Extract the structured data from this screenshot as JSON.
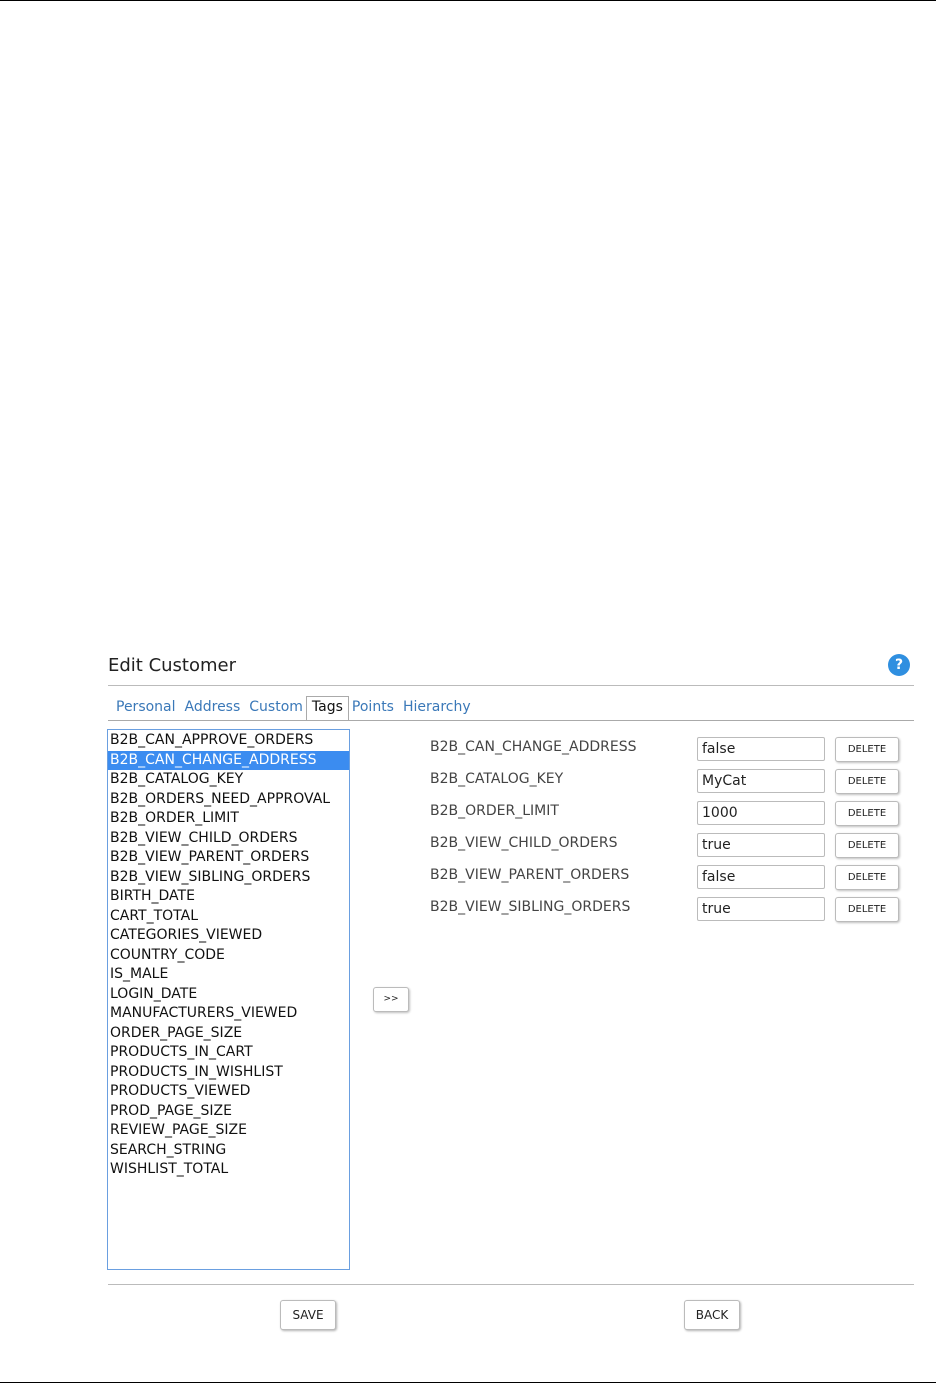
{
  "title": "Edit Customer",
  "help_icon": {
    "glyph": "?",
    "color": "#2f8fe0"
  },
  "tabs": [
    {
      "label": "Personal",
      "active": false
    },
    {
      "label": "Address",
      "active": false
    },
    {
      "label": "Custom",
      "active": false
    },
    {
      "label": "Tags",
      "active": true
    },
    {
      "label": "Points",
      "active": false
    },
    {
      "label": "Hierarchy",
      "active": false
    }
  ],
  "tag_list": {
    "selected": "B2B_CAN_CHANGE_ADDRESS",
    "items": [
      "B2B_CAN_APPROVE_ORDERS",
      "B2B_CAN_CHANGE_ADDRESS",
      "B2B_CATALOG_KEY",
      "B2B_ORDERS_NEED_APPROVAL",
      "B2B_ORDER_LIMIT",
      "B2B_VIEW_CHILD_ORDERS",
      "B2B_VIEW_PARENT_ORDERS",
      "B2B_VIEW_SIBLING_ORDERS",
      "BIRTH_DATE",
      "CART_TOTAL",
      "CATEGORIES_VIEWED",
      "COUNTRY_CODE",
      "IS_MALE",
      "LOGIN_DATE",
      "MANUFACTURERS_VIEWED",
      "ORDER_PAGE_SIZE",
      "PRODUCTS_IN_CART",
      "PRODUCTS_IN_WISHLIST",
      "PRODUCTS_VIEWED",
      "PROD_PAGE_SIZE",
      "REVIEW_PAGE_SIZE",
      "SEARCH_STRING",
      "WISHLIST_TOTAL"
    ]
  },
  "move_button_label": ">>",
  "assigned_tags": [
    {
      "name": "B2B_CAN_CHANGE_ADDRESS",
      "value": "false"
    },
    {
      "name": "B2B_CATALOG_KEY",
      "value": "MyCat"
    },
    {
      "name": "B2B_ORDER_LIMIT",
      "value": "1000"
    },
    {
      "name": "B2B_VIEW_CHILD_ORDERS",
      "value": "true"
    },
    {
      "name": "B2B_VIEW_PARENT_ORDERS",
      "value": "false"
    },
    {
      "name": "B2B_VIEW_SIBLING_ORDERS",
      "value": "true"
    }
  ],
  "delete_label": "DELETE",
  "footer": {
    "save_label": "SAVE",
    "back_label": "BACK"
  },
  "colors": {
    "accent": "#3b8cf0",
    "link": "#3a78b8",
    "list_border": "#6a9fe0"
  }
}
